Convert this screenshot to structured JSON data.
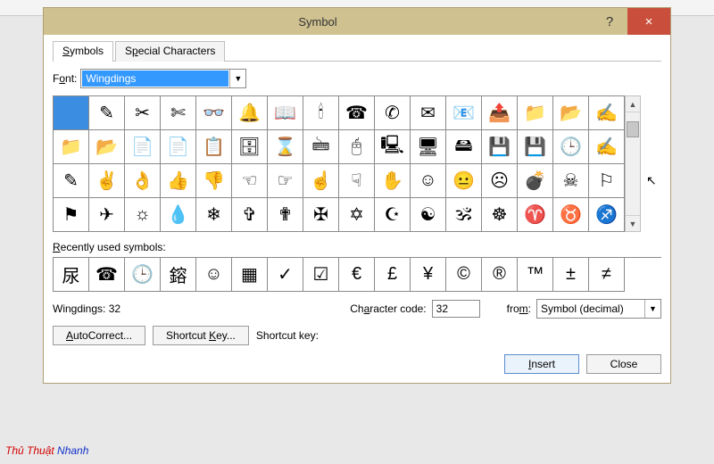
{
  "titlebar": {
    "title": "Symbol",
    "help": "?",
    "close": "×"
  },
  "tabs": {
    "symbols": "Symbols",
    "special": "Special Characters"
  },
  "font": {
    "label_pre": "F",
    "label_u": "o",
    "label_post": "nt:",
    "value": "Wingdings"
  },
  "grid_rows": [
    [
      " ",
      "✎",
      "✂",
      "✄",
      "👓",
      "🔔",
      "📖",
      "🕯",
      "☎",
      "✆",
      "✉",
      "📧",
      "📤",
      "📁",
      "📂",
      "✍"
    ],
    [
      "📁",
      "📂",
      "📄",
      "📄",
      "📋",
      "🗄",
      "⌛",
      "🖮",
      "🖰",
      "🖳",
      "🖥",
      "🖴",
      "💾",
      "💾",
      "🕒",
      "✍"
    ],
    [
      "✎",
      "✌",
      "👌",
      "👍",
      "👎",
      "☜",
      "☞",
      "☝",
      "☟",
      "✋",
      "☺",
      "😐",
      "☹",
      "💣",
      "☠",
      "⚐"
    ],
    [
      "⚑",
      "✈",
      "☼",
      "💧",
      "❄",
      "✞",
      "✟",
      "✠",
      "✡",
      "☪",
      "☯",
      "🕉",
      "☸",
      "♈",
      "♉",
      "♐"
    ]
  ],
  "recent": {
    "label_pre": "",
    "label_u": "R",
    "label_post": "ecently used symbols:"
  },
  "recent_cells": [
    "尿",
    "☎",
    "🕒",
    "鎔",
    "☺",
    "▦",
    "✓",
    "☑",
    "€",
    "£",
    "¥",
    "©",
    "®",
    "™",
    "±",
    "≠"
  ],
  "info": {
    "name": "Wingdings: 32",
    "code_label_pre": "Ch",
    "code_label_u": "a",
    "code_label_post": "racter code:",
    "code_value": "32",
    "from_label_pre": "fro",
    "from_label_u": "m",
    "from_label_post": ":",
    "from_value": "Symbol (decimal)"
  },
  "buttons": {
    "autocorrect": "AutoCorrect...",
    "shortcut": "Shortcut Key...",
    "shortcut_label": "Shortcut key:",
    "insert": "Insert",
    "close": "Close"
  },
  "watermark": {
    "part1": "Thủ Thuật",
    "part2": " Nhanh"
  }
}
